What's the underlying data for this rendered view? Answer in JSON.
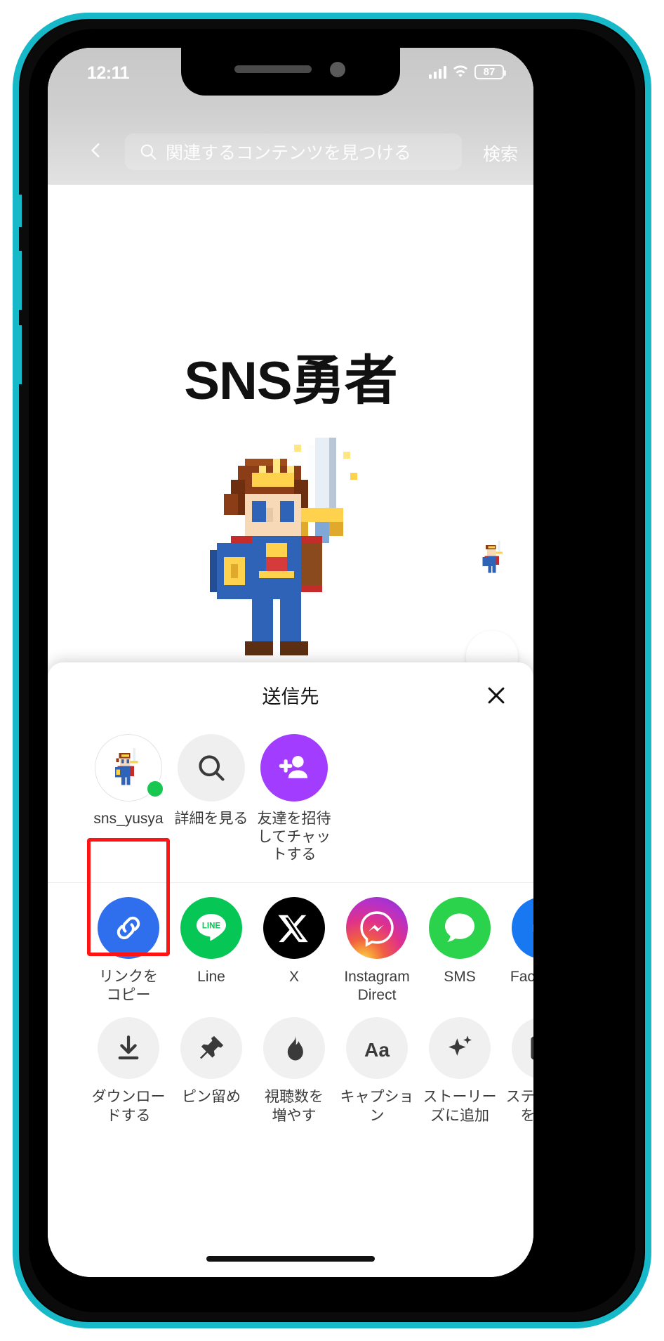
{
  "status_bar": {
    "time": "12:11",
    "battery_percent": "87",
    "signal_icon": "cellular-signal-icon",
    "wifi_icon": "wifi-icon",
    "battery_icon": "battery-icon"
  },
  "top_header": {
    "back_icon": "back-chevron-icon",
    "search_icon": "search-icon",
    "search_placeholder": "関連するコンテンツを見つける",
    "search_value": "",
    "search_button_label": "検索"
  },
  "video": {
    "title": "SNS勇者",
    "hero_sprite_icon": "pixel-hero-sprite",
    "mini_sprite_icon": "pixel-hero-mini-sprite",
    "like_icon": "heart-icon"
  },
  "share_sheet": {
    "title": "送信先",
    "close_icon": "close-icon",
    "people": [
      {
        "label": "sns_yusya",
        "icon": "user-avatar-sprite",
        "online": true,
        "style": "avatar"
      },
      {
        "label": "詳細を見る",
        "icon": "search-icon",
        "online": false,
        "style": "grey"
      },
      {
        "label": "友達を招待してチャットする",
        "icon": "add-friend-icon",
        "online": false,
        "style": "purple"
      }
    ],
    "app_row": [
      {
        "label": "リンクを\nコピー",
        "icon": "link-icon",
        "style": "ico-blue",
        "highlighted": true
      },
      {
        "label": "Line",
        "icon": "line-icon",
        "style": "ico-line",
        "highlighted": false
      },
      {
        "label": "X",
        "icon": "x-icon",
        "style": "ico-x",
        "highlighted": false
      },
      {
        "label": "Instagram\nDirect",
        "icon": "messenger-icon",
        "style": "ico-ig",
        "highlighted": false
      },
      {
        "label": "SMS",
        "icon": "sms-bubble-icon",
        "style": "ico-sms",
        "highlighted": false
      },
      {
        "label": "Facebook",
        "icon": "facebook-icon",
        "style": "ico-fb",
        "highlighted": false
      }
    ],
    "action_row": [
      {
        "label": "ダウンロー\nドする",
        "icon": "download-icon"
      },
      {
        "label": "ピン留め",
        "icon": "pin-icon"
      },
      {
        "label": "視聴数を\n増やす",
        "icon": "flame-icon"
      },
      {
        "label": "キャプショ\nン",
        "icon": "text-aa-icon"
      },
      {
        "label": "ストーリー\nズに追加",
        "icon": "sparkle-icon"
      },
      {
        "label": "ステッカー\nを作成",
        "icon": "sticker-icon"
      }
    ]
  },
  "colors": {
    "highlight_box": "#ff1414",
    "accent_blue": "#2f6fed",
    "line_green": "#06c755",
    "sms_green": "#2ad34b",
    "facebook_blue": "#1778f2",
    "purple": "#a23cff",
    "online_green": "#18c74f",
    "phone_frame": "#17b9c9"
  }
}
